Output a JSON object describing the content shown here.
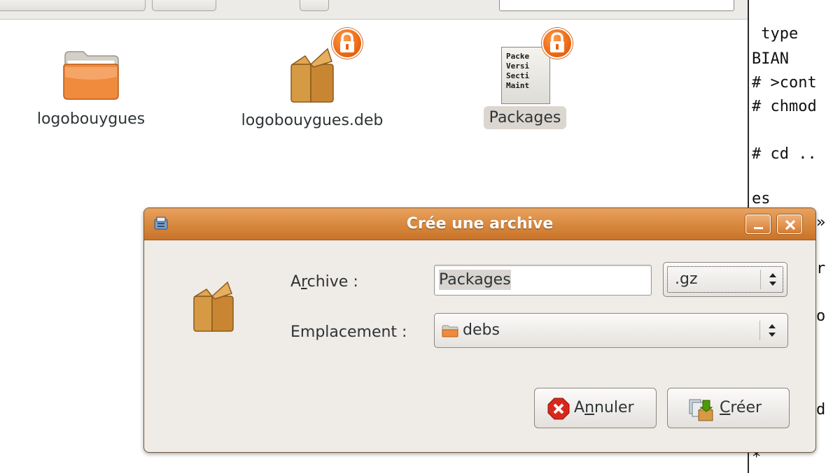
{
  "file_manager": {
    "items": [
      {
        "name": "logobouygues",
        "icon": "folder-icon",
        "locked": false,
        "selected": false
      },
      {
        "name": "logobouygues.deb",
        "icon": "package-icon",
        "locked": true,
        "selected": false
      },
      {
        "name": "Packages",
        "icon": "text-file-icon",
        "locked": true,
        "selected": true,
        "preview_lines": [
          "Packe",
          "Versi",
          "Secti",
          "Maint"
        ]
      }
    ]
  },
  "terminal": {
    "lines": [
      " type",
      "BIAN",
      "# >cont",
      "# chmod",
      "# cd ..",
      "es",
      "»",
      "r",
      "o",
      "d",
      "*"
    ]
  },
  "dialog": {
    "title": "Crée une archive",
    "archive_label_prefix": "A",
    "archive_label_mnemonic": "r",
    "archive_label_suffix": "chive :",
    "archive_value": "Packages",
    "extension_value": ".gz",
    "location_label": "Emplacement :",
    "location_value": "debs",
    "cancel_prefix": "A",
    "cancel_mnemonic": "n",
    "cancel_suffix": "nuler",
    "create_mnemonic": "C",
    "create_suffix": "réer"
  },
  "colors": {
    "titlebar": "#d98a3f",
    "dialog_bg": "#efebe7",
    "lock_badge": "#e8620d",
    "selection": "#dcd6d0"
  }
}
